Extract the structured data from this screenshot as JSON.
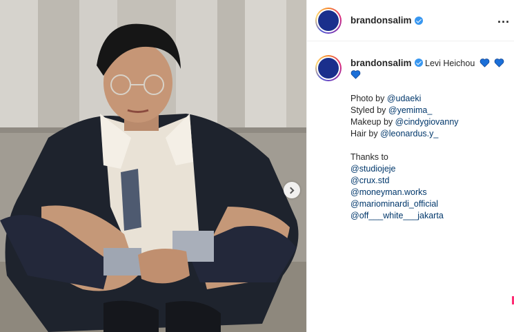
{
  "header": {
    "username": "brandonsalim",
    "more_label": "..."
  },
  "caption": {
    "username": "brandonsalim",
    "first_text": "Levi Heichou",
    "credits": [
      {
        "prefix": "Photo by ",
        "handle": "@udaeki"
      },
      {
        "prefix": "Styled by ",
        "handle": "@yemima_"
      },
      {
        "prefix": "Makeup by ",
        "handle": "@cindygiovanny"
      },
      {
        "prefix": "Hair by ",
        "handle": "@leonardus.y_"
      }
    ],
    "thanks_label": "Thanks to",
    "thanks": [
      "@studiojeje",
      "@crux.std",
      "@moneyman.works",
      "@mariominardi_official",
      "@off___white___jakarta"
    ]
  },
  "colors": {
    "heart": "#1b6fd8",
    "verified": "#3897f0",
    "mention": "#00376b",
    "avatar_fill": "#1a2f8c"
  },
  "icons": [
    "verified-badge-icon",
    "blue-heart-icon",
    "chevron-right-icon",
    "more-options-icon"
  ]
}
